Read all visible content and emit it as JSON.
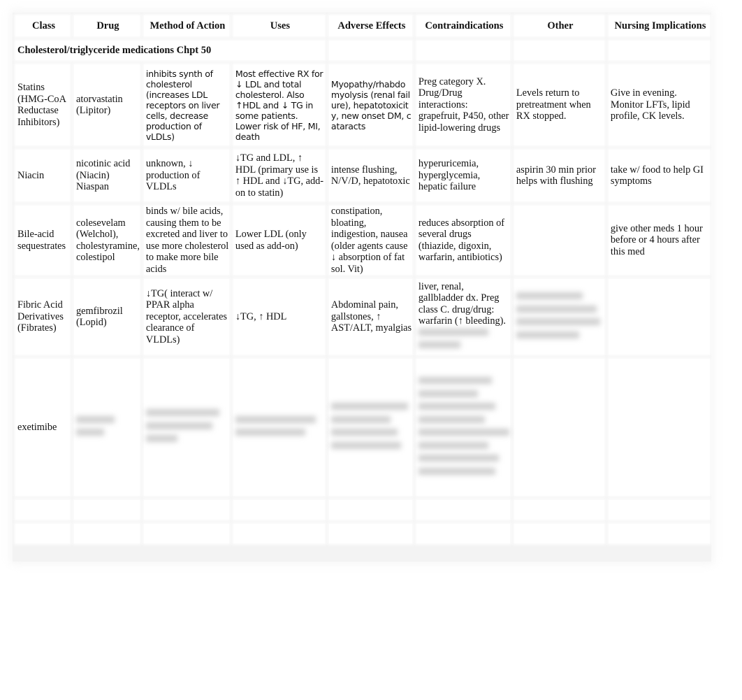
{
  "document": {
    "columns": [
      "Class",
      "Drug",
      "Method of Action",
      "Uses",
      "Adverse Effects",
      "Contraindications",
      "Other",
      "Nursing Implications"
    ],
    "section_title": "Cholesterol/triglyceride medications Chpt 50",
    "rows": [
      {
        "class": "Statins (HMG-CoA Reductase Inhibitors)",
        "drug": "atorvastatin (Lipitor)",
        "method_of_action": "inhibits synth of cholesterol (increases LDL receptors on liver cells, decrease production of vLDLs)",
        "uses": "Most effective RX for ↓ LDL and total cholesterol. Also ↑HDL and ↓ TG in some patients. Lower risk of HF, MI, death",
        "adverse_effects": "Myopathy/rhabdomyolysis (renal failure), hepatotoxicity, new onset DM, cataracts",
        "contraindications": "Preg category X. Drug/Drug interactions: grapefruit, P450, other lipid-lowering drugs",
        "other": "Levels return to pretreatment when RX stopped.",
        "nursing_implications": "Give in evening. Monitor LFTs, lipid profile, CK levels."
      },
      {
        "class": "Niacin",
        "drug": "nicotinic acid (Niacin) Niaspan",
        "method_of_action": "unknown, ↓ production of VLDLs",
        "uses": "↓TG and LDL, ↑ HDL (primary use is ↑ HDL and ↓TG, add-on to statin)",
        "adverse_effects": "intense flushing, N/V/D, hepatotoxic",
        "contraindications": "hyperuricemia, hyperglycemia, hepatic failure",
        "other": "aspirin 30 min prior helps with flushing",
        "nursing_implications": "take w/ food to help GI symptoms"
      },
      {
        "class": "Bile-acid sequestrates",
        "drug": "colesevelam (Welchol), cholestyramine, colestipol",
        "method_of_action": "binds w/ bile acids, causing them to be excreted and liver to use more cholesterol to make more bile acids",
        "uses": "Lower LDL (only used as add-on)",
        "adverse_effects": "constipation, bloating, indigestion, nausea (older agents cause ↓ absorption of fat sol. Vit)",
        "contraindications": "reduces absorption of several drugs (thiazide, digoxin, warfarin, antibiotics)",
        "other": "",
        "nursing_implications": "give other meds 1 hour before or 4 hours after this med"
      },
      {
        "class": "Fibric Acid Derivatives (Fibrates)",
        "drug": "gemfibrozil (Lopid)",
        "method_of_action": "↓TG( interact w/ PPAR alpha receptor, accelerates clearance of VLDLs)",
        "uses": "↓TG, ↑ HDL",
        "adverse_effects": "Abdominal pain, gallstones, ↑ AST/ALT, myalgias",
        "contraindications": "liver, renal, gallbladder dx. Preg class C. drug/drug: warfarin (↑ bleeding).",
        "other": "",
        "nursing_implications": ""
      },
      {
        "class": "exetimibe",
        "drug": "",
        "method_of_action": "",
        "uses": "",
        "adverse_effects": "",
        "contraindications": "",
        "other": "",
        "nursing_implications": ""
      }
    ]
  }
}
